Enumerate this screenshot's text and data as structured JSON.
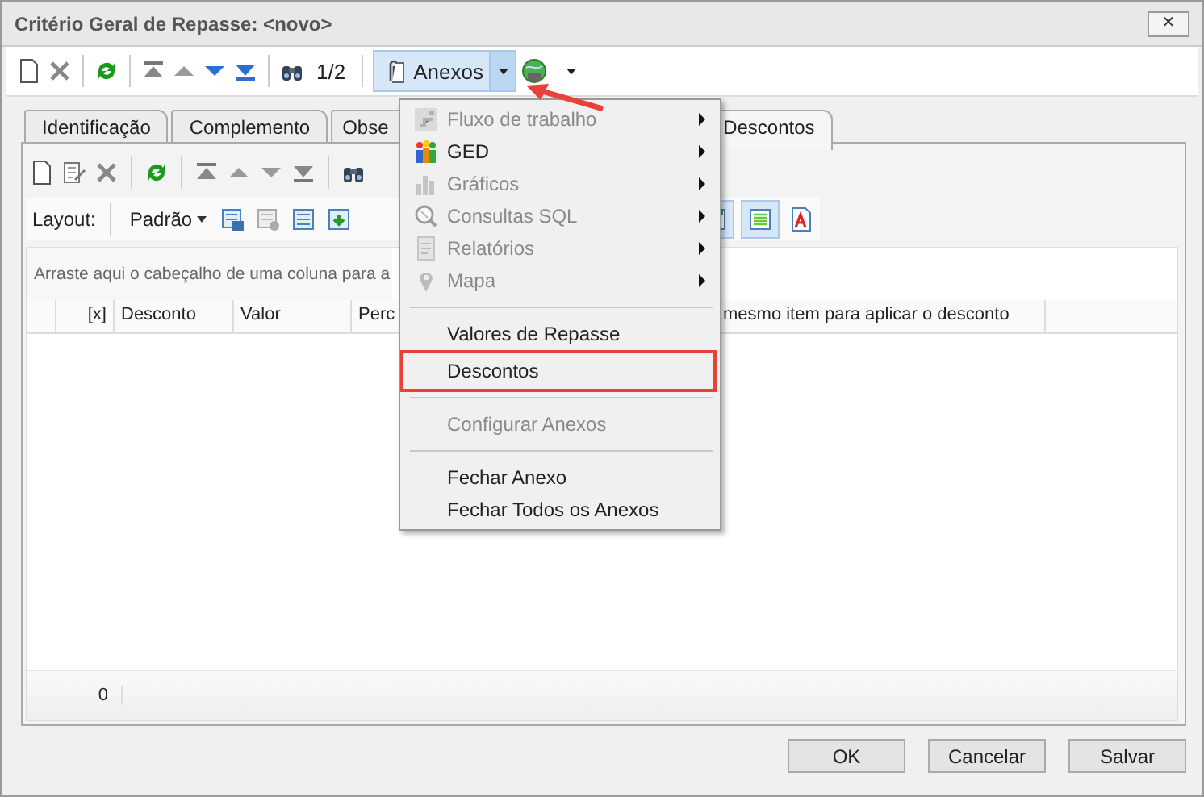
{
  "window": {
    "title": "Critério Geral de Repasse: <novo>",
    "close": "✕"
  },
  "toolbar": {
    "page": "1/2",
    "attachments_button": "Anexos"
  },
  "tabs": [
    {
      "label": "Identificação",
      "selected": false
    },
    {
      "label": "Complemento",
      "selected": false
    },
    {
      "label": "Obse",
      "selected": false
    },
    {
      "label": "Descontos",
      "selected": true
    }
  ],
  "layout_bar": {
    "label": "Layout:",
    "preset": "Padrão"
  },
  "group_panel": {
    "hint": "Arraste aqui o cabeçalho de uma coluna para a"
  },
  "table": {
    "columns": [
      "[x]",
      "Desconto",
      "Valor",
      "Perc",
      "mesmo item para aplicar o desconto"
    ],
    "footer": "0"
  },
  "menu": {
    "items": [
      {
        "kind": "submenu",
        "label": "Fluxo de trabalho",
        "disabled": true,
        "annotated": false
      },
      {
        "kind": "submenu",
        "label": "GED",
        "disabled": false,
        "annotated": false
      },
      {
        "kind": "submenu",
        "label": "Gráficos",
        "disabled": true,
        "annotated": false
      },
      {
        "kind": "submenu",
        "label": "Consultas SQL",
        "disabled": true,
        "annotated": false
      },
      {
        "kind": "submenu",
        "label": "Relatórios",
        "disabled": true,
        "annotated": false
      },
      {
        "kind": "submenu",
        "label": "Mapa",
        "disabled": true,
        "annotated": false
      },
      {
        "kind": "separator"
      },
      {
        "kind": "item",
        "label": "Valores de Repasse",
        "disabled": false,
        "annotated": false
      },
      {
        "kind": "item",
        "label": "Descontos",
        "disabled": false,
        "annotated": true
      },
      {
        "kind": "separator"
      },
      {
        "kind": "item",
        "label": "Configurar Anexos",
        "disabled": true,
        "annotated": false
      },
      {
        "kind": "separator"
      },
      {
        "kind": "item",
        "label": "Fechar Anexo",
        "disabled": false,
        "annotated": false
      },
      {
        "kind": "item",
        "label": "Fechar Todos os Anexos",
        "disabled": false,
        "annotated": false
      }
    ]
  },
  "buttons": [
    "OK",
    "Cancelar",
    "Salvar"
  ]
}
